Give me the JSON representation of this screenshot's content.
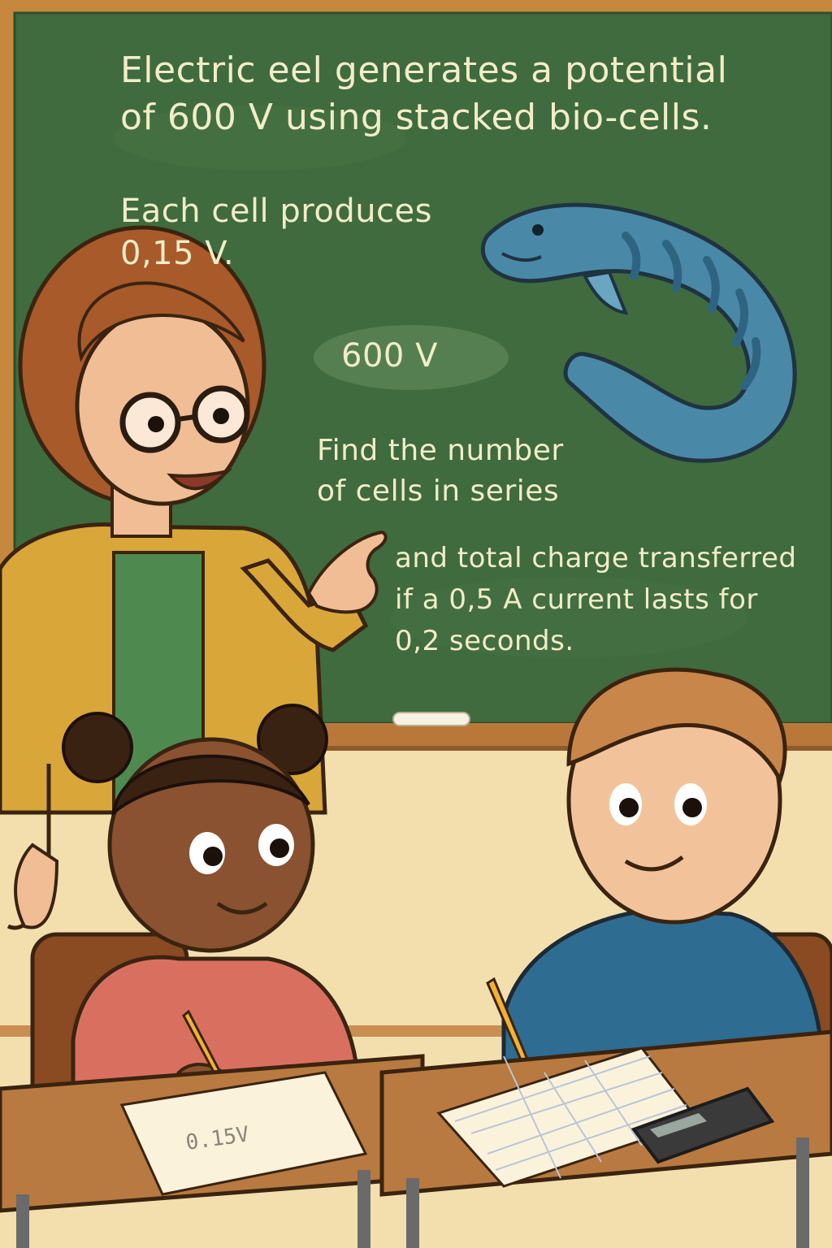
{
  "board": {
    "title": "Electric eel generates a potential\nof 600 V using stacked bio-cells.",
    "cell_info": "Each cell produces\n0,15 V.",
    "voltage_label": "600 V",
    "task_part1": "Find the number\nof cells in series",
    "task_part2": "and total charge transferred\nif a 0,5 A current lasts for\n0,2 seconds."
  },
  "desk": {
    "worksheet_note": "0.15V"
  },
  "colors": {
    "chalkboard": "#3f6b3e",
    "board_frame": "#c6873e",
    "wall": "#f0d9a4",
    "chalk": "#f2ecc8",
    "eel": "#4a88a8",
    "teacher_cardigan": "#d9a63a",
    "girl_shirt": "#d9705f",
    "boy_shirt": "#2f6c92",
    "desk": "#b87a40"
  }
}
